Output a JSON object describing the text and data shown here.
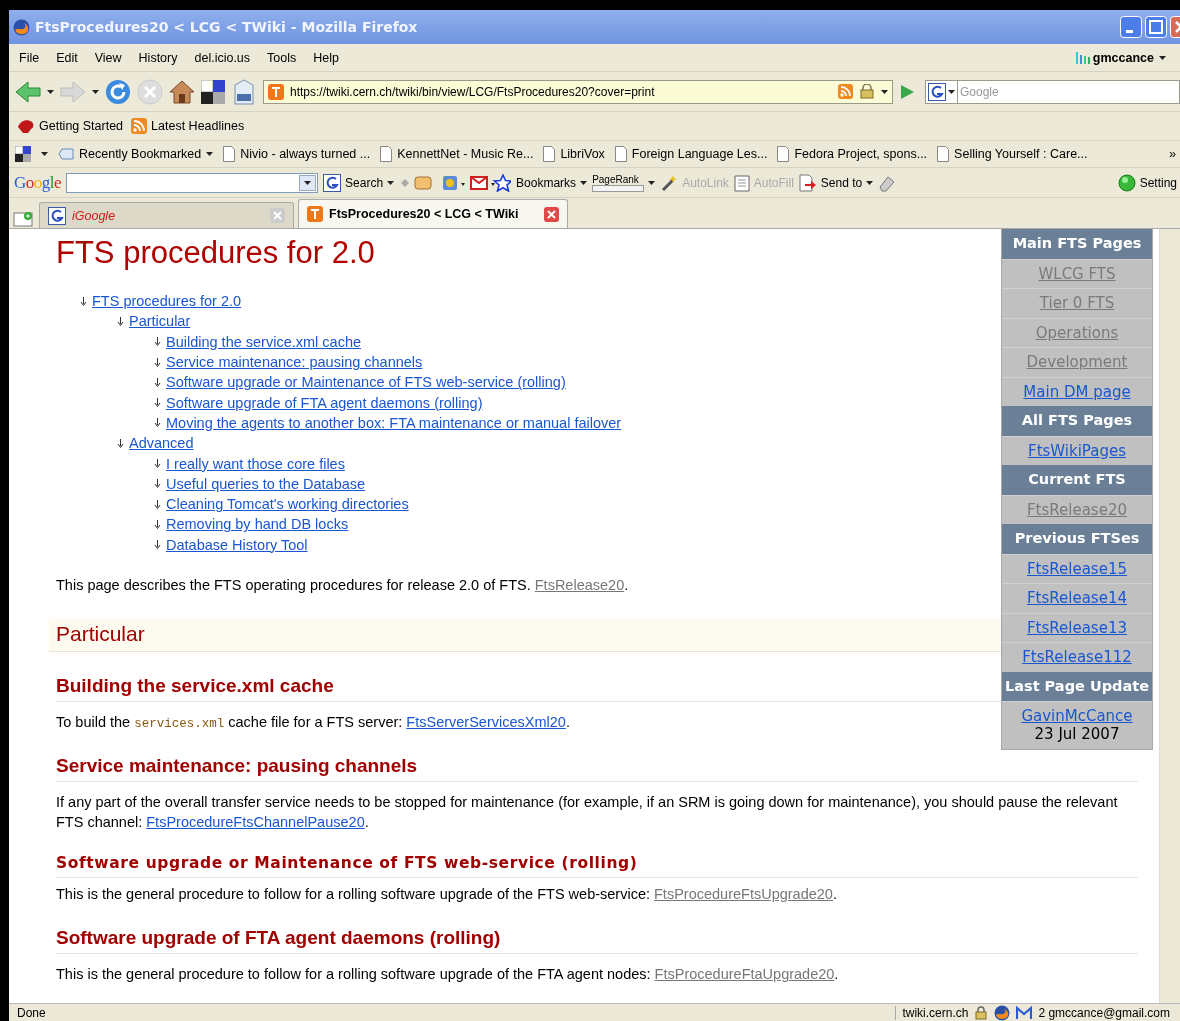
{
  "window": {
    "title": "FtsProcedures20 < LCG < TWiki - Mozilla Firefox"
  },
  "menu": [
    "File",
    "Edit",
    "View",
    "History",
    "del.icio.us",
    "Tools",
    "Help"
  ],
  "account": {
    "name": "gmccance"
  },
  "navigation": {
    "url": "https://twiki.cern.ch/twiki/bin/view/LCG/FtsProcedures20?cover=print",
    "search_placeholder": "Google"
  },
  "toolbar_links": [
    {
      "label": "Getting Started",
      "kind": "start"
    },
    {
      "label": "Latest Headlines",
      "kind": "feed"
    }
  ],
  "bookmarks": [
    {
      "label": "Recently Bookmarked",
      "kind": "menu"
    },
    {
      "label": "Nivio - always turned ...",
      "kind": "page"
    },
    {
      "label": "KennettNet - Music Re...",
      "kind": "page"
    },
    {
      "label": "LibriVox",
      "kind": "page"
    },
    {
      "label": "Foreign Language Les...",
      "kind": "page"
    },
    {
      "label": "Fedora Project, spons...",
      "kind": "page"
    },
    {
      "label": "Selling Yourself : Care...",
      "kind": "page"
    }
  ],
  "bookmarks_more": "»",
  "google_toolbar": {
    "logo": "Google",
    "items": [
      {
        "label": "Search",
        "kind": "search",
        "disabled": false
      },
      {
        "label": "Bookmarks",
        "kind": "menu",
        "disabled": false
      },
      {
        "label": "PageRank",
        "kind": "pagerank",
        "disabled": false
      },
      {
        "label": "AutoLink",
        "kind": "autolink",
        "disabled": true
      },
      {
        "label": "AutoFill",
        "kind": "autofill",
        "disabled": true
      },
      {
        "label": "Send to",
        "kind": "sendto",
        "disabled": false
      },
      {
        "label": "Setting",
        "kind": "settings",
        "disabled": false
      }
    ]
  },
  "tabs": [
    {
      "label": "iGoogle",
      "selected": false
    },
    {
      "label": "FtsProcedures20 < LCG < TWiki",
      "selected": true
    }
  ],
  "page": {
    "title": "FTS procedures for 2.0",
    "toc": [
      {
        "label": "FTS procedures for 2.0",
        "children": [
          {
            "label": "Particular",
            "children": [
              {
                "label": "Building the service.xml cache"
              },
              {
                "label": "Service maintenance: pausing channels"
              },
              {
                "label": "Software upgrade or Maintenance of FTS web-service (rolling)"
              },
              {
                "label": "Software upgrade of FTA agent daemons (rolling)"
              },
              {
                "label": "Moving the agents to another box: FTA maintenance or manual failover"
              }
            ]
          },
          {
            "label": "Advanced",
            "children": [
              {
                "label": "I really want those core files"
              },
              {
                "label": "Useful queries to the Database"
              },
              {
                "label": "Cleaning Tomcat's working directories"
              },
              {
                "label": "Removing by hand DB locks"
              },
              {
                "label": "Database History Tool"
              }
            ]
          }
        ]
      }
    ],
    "blocks": [
      {
        "kind": "paragraph",
        "parts": [
          {
            "text": "This page describes the FTS operating procedures for release 2.0 of FTS. "
          },
          {
            "link": "FtsRelease20",
            "visited": true
          },
          {
            "text": "."
          }
        ]
      },
      {
        "kind": "section",
        "title": "Particular"
      },
      {
        "kind": "heading",
        "title": "Building the service.xml cache"
      },
      {
        "kind": "paragraph",
        "parts": [
          {
            "text": "To build the "
          },
          {
            "code": "services.xml"
          },
          {
            "text": " cache file for a FTS server: "
          },
          {
            "link": "FtsServerServicesXml20",
            "visited": false
          },
          {
            "text": "."
          }
        ]
      },
      {
        "kind": "heading",
        "title": "Service maintenance: pausing channels"
      },
      {
        "kind": "paragraph",
        "parts": [
          {
            "text": "If any part of the overall transfer service needs to be stopped for maintenance (for example, if an SRM is going down for maintenance), you should pause the relevant FTS channel: "
          },
          {
            "link": "FtsProcedureFtsChannelPause20",
            "visited": false
          },
          {
            "text": "."
          }
        ]
      },
      {
        "kind": "subheading",
        "title": "Software upgrade or Maintenance of FTS web-service (rolling)"
      },
      {
        "kind": "paragraph",
        "parts": [
          {
            "text": "This is the general procedure to follow for a rolling software upgrade of the FTS web-service: "
          },
          {
            "link": "FtsProcedureFtsUpgrade20",
            "visited": true
          },
          {
            "text": "."
          }
        ]
      },
      {
        "kind": "heading",
        "title": "Software upgrade of FTA agent daemons (rolling)"
      },
      {
        "kind": "paragraph",
        "parts": [
          {
            "text": "This is the general procedure to follow for a rolling software upgrade of the FTA agent nodes: "
          },
          {
            "link": "FtsProcedureFtaUpgrade20",
            "visited": true
          },
          {
            "text": "."
          }
        ]
      }
    ]
  },
  "sidebar": [
    {
      "kind": "header",
      "label": "Main FTS Pages"
    },
    {
      "kind": "link",
      "label": "WLCG FTS",
      "visited": true
    },
    {
      "kind": "link",
      "label": "Tier 0 FTS",
      "visited": true
    },
    {
      "kind": "link",
      "label": "Operations",
      "visited": true
    },
    {
      "kind": "link",
      "label": "Development",
      "visited": true
    },
    {
      "kind": "link",
      "label": "Main DM page",
      "visited": false
    },
    {
      "kind": "header",
      "label": "All FTS Pages"
    },
    {
      "kind": "link",
      "label": "FtsWikiPages",
      "visited": false
    },
    {
      "kind": "header",
      "label": "Current FTS"
    },
    {
      "kind": "link",
      "label": "FtsRelease20",
      "visited": true
    },
    {
      "kind": "header",
      "label": "Previous FTSes"
    },
    {
      "kind": "link",
      "label": "FtsRelease15",
      "visited": false
    },
    {
      "kind": "link",
      "label": "FtsRelease14",
      "visited": false
    },
    {
      "kind": "link",
      "label": "FtsRelease13",
      "visited": false
    },
    {
      "kind": "link",
      "label": "FtsRelease112",
      "visited": false
    },
    {
      "kind": "header",
      "label": "Last Page Update"
    },
    {
      "kind": "link",
      "label": "GavinMcCance",
      "visited": false
    },
    {
      "kind": "date",
      "label": "23 Jul 2007"
    }
  ],
  "status_bar": {
    "text": "Done",
    "host": "twiki.cern.ch",
    "mail": "2 gmccance@gmail.com"
  }
}
